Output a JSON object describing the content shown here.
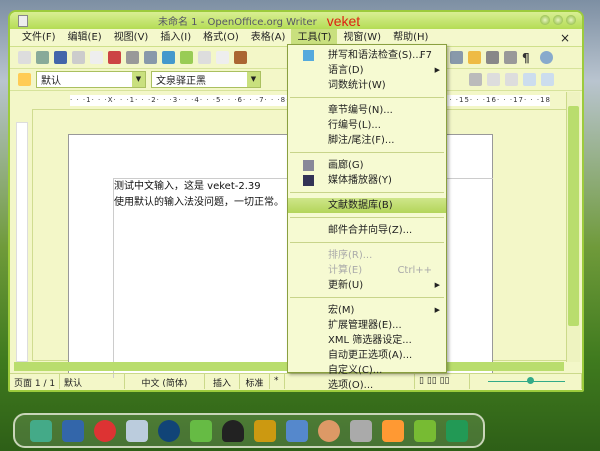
{
  "window": {
    "title": "未命名 1 - OpenOffice.org Writer",
    "brand": "veket"
  },
  "menubar": {
    "items": [
      "文件(F)",
      "编辑(E)",
      "视图(V)",
      "插入(I)",
      "格式(O)",
      "表格(A)",
      "工具(T)",
      "视窗(W)",
      "帮助(H)"
    ],
    "close": "×"
  },
  "formatting": {
    "style": "默认",
    "font": "文泉驿正黑"
  },
  "ruler": {
    "text": "· · ·1· · ·X· · ·1· · ·2· · ·3· · ·4· · ·5· · ·6· · ·7· · ·8· · ·9· · ·10· · ·11· · ·12· · ·13· · ·14· · ·15· · ·16· · ·17· · ·18· · ·19"
  },
  "document": {
    "lines": [
      "测试中文输入，这是 veket-2.39",
      "使用默认的输入法没问题，一切正常。"
    ]
  },
  "tools_menu": {
    "groups": [
      [
        {
          "label": "拼写和语法检查(S)...",
          "shortcut": "F7",
          "icon": "spellcheck-icon"
        },
        {
          "label": "语言(D)",
          "submenu": true
        },
        {
          "label": "词数统计(W)"
        }
      ],
      [
        {
          "label": "章节编号(N)..."
        },
        {
          "label": "行编号(L)..."
        },
        {
          "label": "脚注/尾注(F)..."
        }
      ],
      [
        {
          "label": "画廊(G)",
          "icon": "gallery-icon"
        },
        {
          "label": "媒体播放器(Y)",
          "icon": "media-player-icon"
        }
      ],
      [
        {
          "label": "文献数据库(B)",
          "highlighted": true
        }
      ],
      [
        {
          "label": "邮件合并向导(Z)..."
        }
      ],
      [
        {
          "label": "排序(R)...",
          "disabled": true
        },
        {
          "label": "计算(E)",
          "shortcut": "Ctrl++",
          "disabled": true
        },
        {
          "label": "更新(U)",
          "submenu": true
        }
      ],
      [
        {
          "label": "宏(M)",
          "submenu": true
        },
        {
          "label": "扩展管理器(E)..."
        },
        {
          "label": "XML 筛选器设定..."
        },
        {
          "label": "自动更正选项(A)..."
        },
        {
          "label": "自定义(C)..."
        },
        {
          "label": "选项(O)..."
        }
      ]
    ]
  },
  "statusbar": {
    "page": "页面 1 / 1",
    "style": "默认",
    "language": "中文 (简体)",
    "insert": "插入",
    "mode": "标准",
    "modified": "*"
  },
  "zoom": {
    "level_fraction": 0.5
  },
  "colors": {
    "accent": "#b4dc55",
    "highlight": "#c9e07e"
  }
}
